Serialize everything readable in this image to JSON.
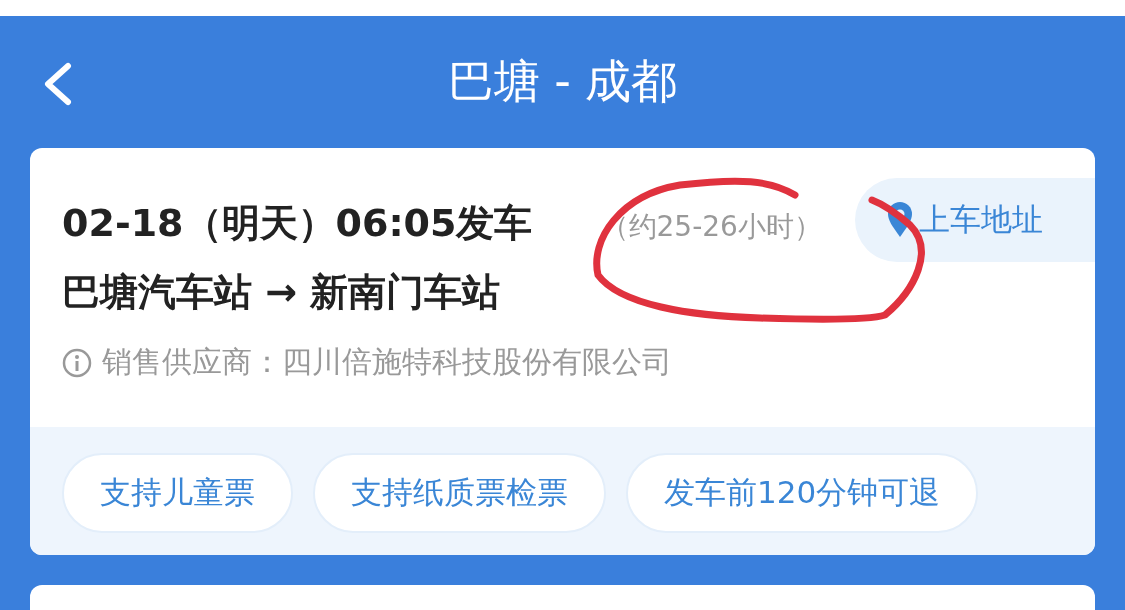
{
  "header": {
    "title": "巴塘 - 成都"
  },
  "trip": {
    "departure": "02-18（明天）06:05发车",
    "duration": "（约25-26小时）",
    "route": "巴塘汽车站 → 新南门车站",
    "supplier": "销售供应商：四川倍施特科技股份有限公司",
    "pickup_button": "上车地址"
  },
  "tags": [
    "支持儿童票",
    "支持纸质票检票",
    "发车前120分钟可退"
  ]
}
